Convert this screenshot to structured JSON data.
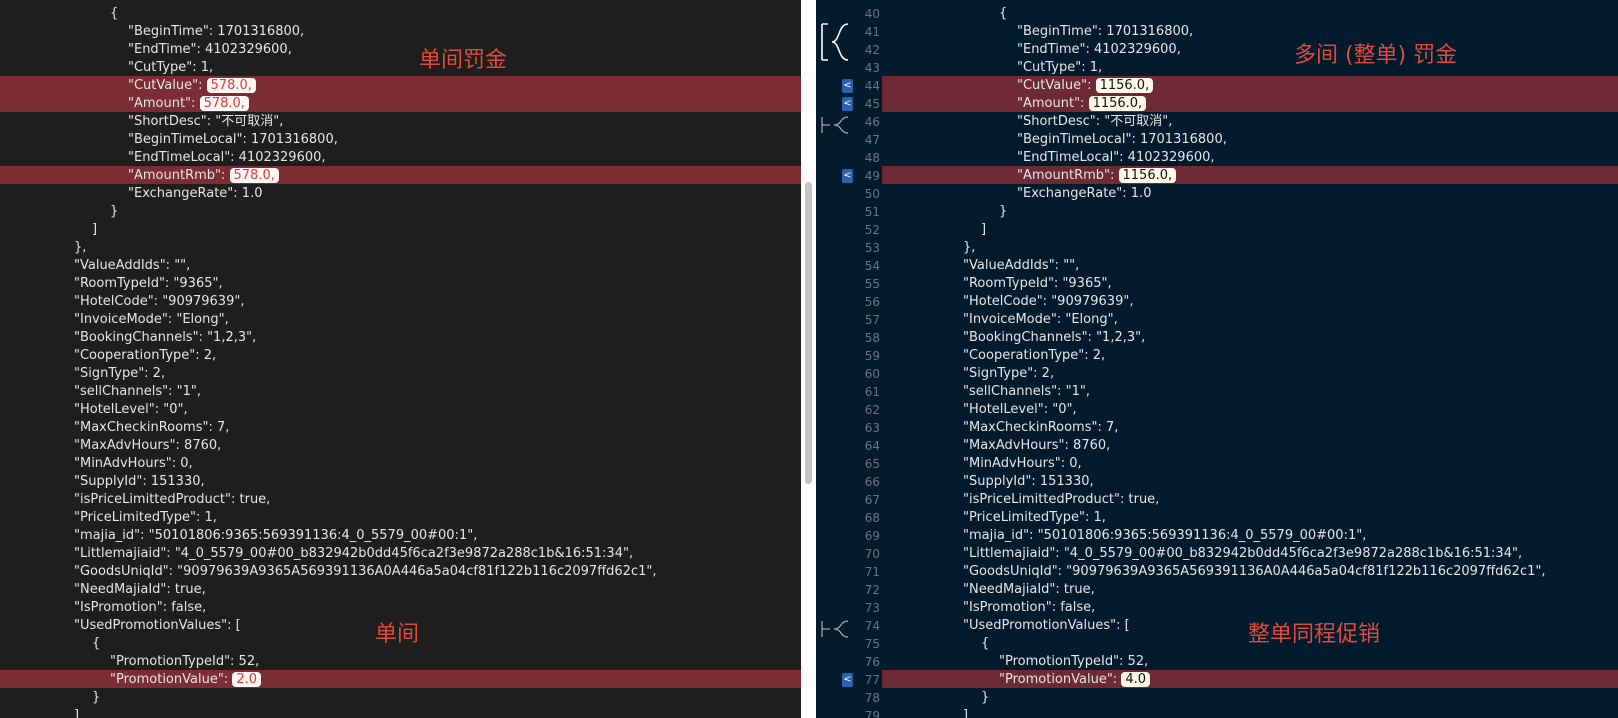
{
  "annotations": {
    "left_penalty": "单间罚金",
    "left_promo": "单间",
    "right_penalty": "多间 (整单) 罚金",
    "right_promo": "整单同程促销"
  },
  "gutter": {
    "diff_arrow": "<",
    "line_numbers": [
      "40",
      "41",
      "42",
      "43",
      "44",
      "45",
      "46",
      "47",
      "48",
      "49",
      "50",
      "51",
      "52",
      "53",
      "54",
      "55",
      "56",
      "57",
      "58",
      "59",
      "60",
      "61",
      "62",
      "63",
      "64",
      "65",
      "66",
      "67",
      "68",
      "69",
      "70",
      "71",
      "72",
      "73",
      "74",
      "75",
      "76",
      "77",
      "78",
      "79"
    ]
  },
  "left": {
    "lines": [
      {
        "pre": "{",
        "val": "",
        "post": ""
      },
      {
        "pre": "\"BeginTime\": 1701316800,",
        "val": "",
        "post": ""
      },
      {
        "pre": "\"EndTime\": 4102329600,",
        "val": "",
        "post": ""
      },
      {
        "pre": "\"CutType\": 1,",
        "val": "",
        "post": ""
      },
      {
        "pre": "\"CutValue\": ",
        "val": "578.0,",
        "post": ""
      },
      {
        "pre": "\"Amount\": ",
        "val": "578.0,",
        "post": ""
      },
      {
        "pre": "\"ShortDesc\": \"不可取消\",",
        "val": "",
        "post": ""
      },
      {
        "pre": "\"BeginTimeLocal\": 1701316800,",
        "val": "",
        "post": ""
      },
      {
        "pre": "\"EndTimeLocal\": 4102329600,",
        "val": "",
        "post": ""
      },
      {
        "pre": "\"AmountRmb\": ",
        "val": "578.0,",
        "post": ""
      },
      {
        "pre": "\"ExchangeRate\": 1.0",
        "val": "",
        "post": ""
      },
      {
        "pre": "}",
        "val": "",
        "post": ""
      },
      {
        "pre": "]",
        "val": "",
        "post": ""
      },
      {
        "pre": "},",
        "val": "",
        "post": ""
      },
      {
        "pre": "\"ValueAddIds\": \"\",",
        "val": "",
        "post": ""
      },
      {
        "pre": "\"RoomTypeId\": \"9365\",",
        "val": "",
        "post": ""
      },
      {
        "pre": "\"HotelCode\": \"90979639\",",
        "val": "",
        "post": ""
      },
      {
        "pre": "\"InvoiceMode\": \"Elong\",",
        "val": "",
        "post": ""
      },
      {
        "pre": "\"BookingChannels\": \"1,2,3\",",
        "val": "",
        "post": ""
      },
      {
        "pre": "\"CooperationType\": 2,",
        "val": "",
        "post": ""
      },
      {
        "pre": "\"SignType\": 2,",
        "val": "",
        "post": ""
      },
      {
        "pre": "\"sellChannels\": \"1\",",
        "val": "",
        "post": ""
      },
      {
        "pre": "\"HotelLevel\": \"0\",",
        "val": "",
        "post": ""
      },
      {
        "pre": "\"MaxCheckinRooms\": 7,",
        "val": "",
        "post": ""
      },
      {
        "pre": "\"MaxAdvHours\": 8760,",
        "val": "",
        "post": ""
      },
      {
        "pre": "\"MinAdvHours\": 0,",
        "val": "",
        "post": ""
      },
      {
        "pre": "\"SupplyId\": 151330,",
        "val": "",
        "post": ""
      },
      {
        "pre": "\"isPriceLimittedProduct\": true,",
        "val": "",
        "post": ""
      },
      {
        "pre": "\"PriceLimitedType\": 1,",
        "val": "",
        "post": ""
      },
      {
        "pre": "\"majia_id\": \"50101806:9365:569391136:4_0_5579_00#00:1\",",
        "val": "",
        "post": ""
      },
      {
        "pre": "\"Littlemajiaid\": \"4_0_5579_00#00_b832942b0dd45f6ca2f3e9872a288c1b&16:51:34\",",
        "val": "",
        "post": ""
      },
      {
        "pre": "\"GoodsUniqId\": \"90979639A9365A569391136A0A446a5a04cf81f122b116c2097ffd62c1\",",
        "val": "",
        "post": ""
      },
      {
        "pre": "\"NeedMajiaId\": true,",
        "val": "",
        "post": ""
      },
      {
        "pre": "\"IsPromotion\": false,",
        "val": "",
        "post": ""
      },
      {
        "pre": "\"UsedPromotionValues\": [",
        "val": "",
        "post": ""
      },
      {
        "pre": "{",
        "val": "",
        "post": ""
      },
      {
        "pre": "\"PromotionTypeId\": 52,",
        "val": "",
        "post": ""
      },
      {
        "pre": "\"PromotionValue\": ",
        "val": "2.0",
        "post": ""
      },
      {
        "pre": "}",
        "val": "",
        "post": ""
      },
      {
        "pre": "]",
        "val": "",
        "post": ""
      }
    ]
  },
  "right": {
    "lines": [
      {
        "pre": "{",
        "val": "",
        "post": ""
      },
      {
        "pre": "\"BeginTime\": 1701316800,",
        "val": "",
        "post": ""
      },
      {
        "pre": "\"EndTime\": 4102329600,",
        "val": "",
        "post": ""
      },
      {
        "pre": "\"CutType\": 1,",
        "val": "",
        "post": ""
      },
      {
        "pre": "\"CutValue\": ",
        "val": "1156.0,",
        "post": ""
      },
      {
        "pre": "\"Amount\": ",
        "val": "1156.0,",
        "post": ""
      },
      {
        "pre": "\"ShortDesc\": \"不可取消\",",
        "val": "",
        "post": ""
      },
      {
        "pre": "\"BeginTimeLocal\": 1701316800,",
        "val": "",
        "post": ""
      },
      {
        "pre": "\"EndTimeLocal\": 4102329600,",
        "val": "",
        "post": ""
      },
      {
        "pre": "\"AmountRmb\": ",
        "val": "1156.0,",
        "post": ""
      },
      {
        "pre": "\"ExchangeRate\": 1.0",
        "val": "",
        "post": ""
      },
      {
        "pre": "}",
        "val": "",
        "post": ""
      },
      {
        "pre": "]",
        "val": "",
        "post": ""
      },
      {
        "pre": "},",
        "val": "",
        "post": ""
      },
      {
        "pre": "\"ValueAddIds\": \"\",",
        "val": "",
        "post": ""
      },
      {
        "pre": "\"RoomTypeId\": \"9365\",",
        "val": "",
        "post": ""
      },
      {
        "pre": "\"HotelCode\": \"90979639\",",
        "val": "",
        "post": ""
      },
      {
        "pre": "\"InvoiceMode\": \"Elong\",",
        "val": "",
        "post": ""
      },
      {
        "pre": "\"BookingChannels\": \"1,2,3\",",
        "val": "",
        "post": ""
      },
      {
        "pre": "\"CooperationType\": 2,",
        "val": "",
        "post": ""
      },
      {
        "pre": "\"SignType\": 2,",
        "val": "",
        "post": ""
      },
      {
        "pre": "\"sellChannels\": \"1\",",
        "val": "",
        "post": ""
      },
      {
        "pre": "\"HotelLevel\": \"0\",",
        "val": "",
        "post": ""
      },
      {
        "pre": "\"MaxCheckinRooms\": 7,",
        "val": "",
        "post": ""
      },
      {
        "pre": "\"MaxAdvHours\": 8760,",
        "val": "",
        "post": ""
      },
      {
        "pre": "\"MinAdvHours\": 0,",
        "val": "",
        "post": ""
      },
      {
        "pre": "\"SupplyId\": 151330,",
        "val": "",
        "post": ""
      },
      {
        "pre": "\"isPriceLimittedProduct\": true,",
        "val": "",
        "post": ""
      },
      {
        "pre": "\"PriceLimitedType\": 1,",
        "val": "",
        "post": ""
      },
      {
        "pre": "\"majia_id\": \"50101806:9365:569391136:4_0_5579_00#00:1\",",
        "val": "",
        "post": ""
      },
      {
        "pre": "\"Littlemajiaid\": \"4_0_5579_00#00_b832942b0dd45f6ca2f3e9872a288c1b&16:51:34\",",
        "val": "",
        "post": ""
      },
      {
        "pre": "\"GoodsUniqId\": \"90979639A9365A569391136A0A446a5a04cf81f122b116c2097ffd62c1\",",
        "val": "",
        "post": ""
      },
      {
        "pre": "\"NeedMajiaId\": true,",
        "val": "",
        "post": ""
      },
      {
        "pre": "\"IsPromotion\": false,",
        "val": "",
        "post": ""
      },
      {
        "pre": "\"UsedPromotionValues\": [",
        "val": "",
        "post": ""
      },
      {
        "pre": "{",
        "val": "",
        "post": ""
      },
      {
        "pre": "\"PromotionTypeId\": 52,",
        "val": "",
        "post": ""
      },
      {
        "pre": "\"PromotionValue\": ",
        "val": "4.0",
        "post": ""
      },
      {
        "pre": "}",
        "val": "",
        "post": ""
      },
      {
        "pre": "]",
        "val": "",
        "post": ""
      }
    ]
  }
}
